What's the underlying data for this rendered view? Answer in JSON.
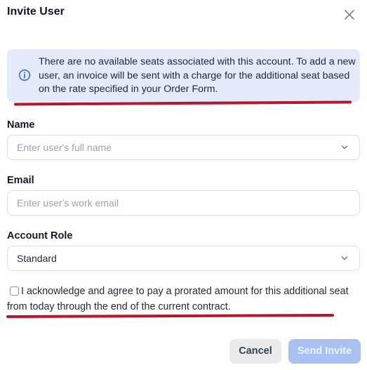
{
  "dialog": {
    "title": "Invite User",
    "close_icon": "close-icon"
  },
  "banner": {
    "icon": "info-icon",
    "text": "There are no available seats associated with this account. To add a new user, an invoice will be sent with a charge for the additional seat based on the rate specified in your Order Form."
  },
  "form": {
    "name": {
      "label": "Name",
      "placeholder": "Enter user's full name"
    },
    "email": {
      "label": "Email",
      "placeholder": "Enter user's work email"
    },
    "role": {
      "label": "Account Role",
      "value": "Standard"
    }
  },
  "acknowledge": {
    "checked": false,
    "text": "I acknowledge and agree to pay a prorated amount for this additional seat from today through the end of the current contract."
  },
  "buttons": {
    "cancel": "Cancel",
    "send": "Send Invite"
  },
  "colors": {
    "banner_bg": "#e3eafa",
    "info_icon": "#3b6fd6",
    "annotation_underline": "#b3182c",
    "send_disabled": "#a8c1f2"
  }
}
